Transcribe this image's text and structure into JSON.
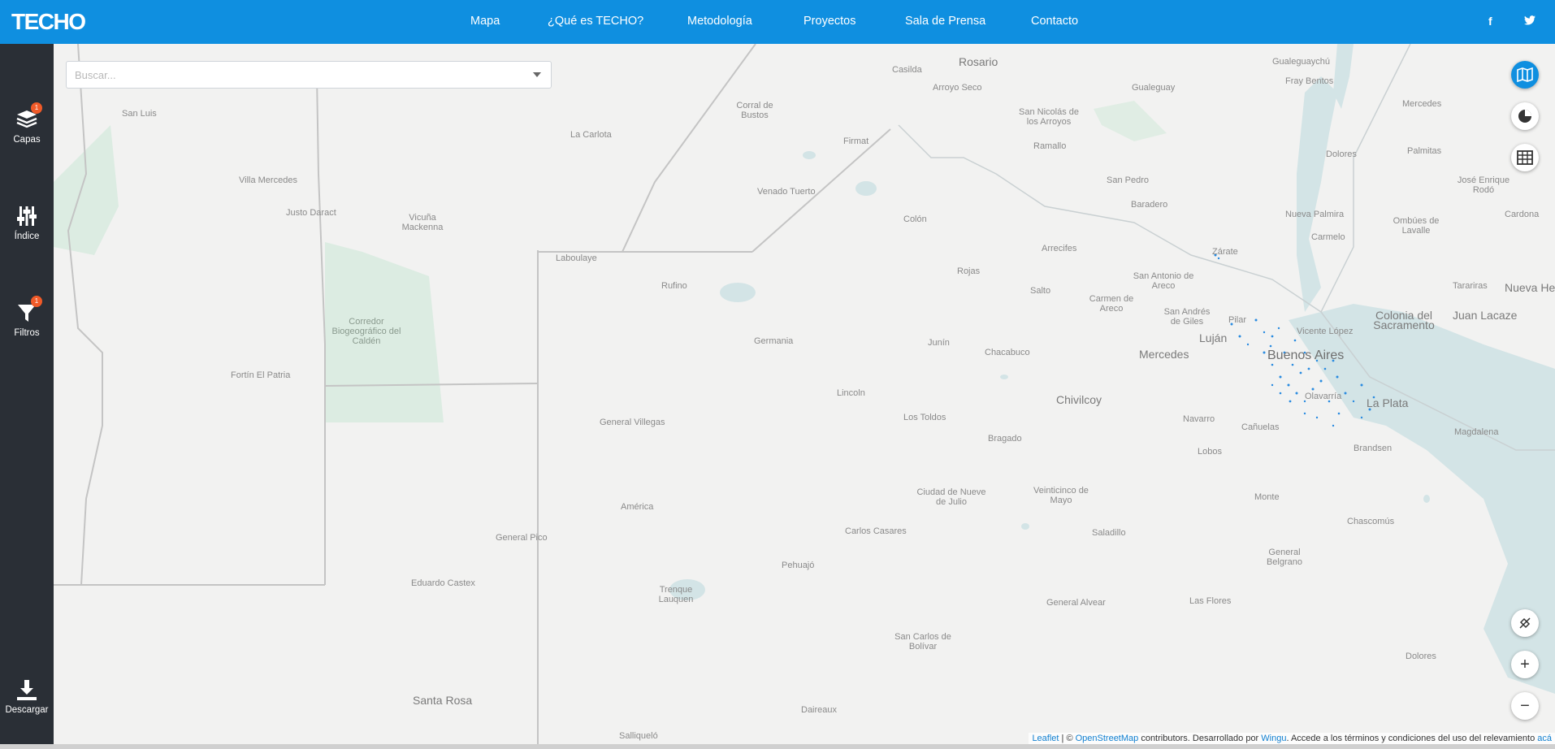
{
  "brand": {
    "logo_text": "TECHO"
  },
  "nav": {
    "items": [
      "Mapa",
      "¿Qué es TECHO?",
      "Metodología",
      "Proyectos",
      "Sala de Prensa",
      "Contacto"
    ],
    "social": [
      "f",
      "t"
    ]
  },
  "sidebar": {
    "layers": {
      "label": "Capas",
      "badge": "1"
    },
    "index": {
      "label": "Índice"
    },
    "filters": {
      "label": "Filtros",
      "badge": "1"
    },
    "download": {
      "label": "Descargar"
    }
  },
  "search": {
    "placeholder": "Buscar..."
  },
  "map": {
    "places": [
      "Rosario",
      "Casilda",
      "Arroyo Seco",
      "San Nicolás de los Arroyos",
      "Gualeguay",
      "Gualeguaychú",
      "Fray Bentos",
      "Mercedes",
      "San Luis",
      "Corral de Bustos",
      "La Carlota",
      "Firmat",
      "Ramallo",
      "Dolores",
      "Palmitas",
      "Villa Mercedes",
      "Justo Daract",
      "Venado Tuerto",
      "San Pedro",
      "Baradero",
      "José Enrique Rodó",
      "Nueva Palmira",
      "Ombúes de Lavalle",
      "Cardona",
      "Vicuña Mackenna",
      "Colón",
      "Carmelo",
      "Arrecifes",
      "Zárate",
      "Laboulaye",
      "Rojas",
      "Tarariras",
      "Nueva Helvecia",
      "Rufino",
      "San Antonio de Areco",
      "Salto",
      "Carmen de Areco",
      "San Andrés de Giles",
      "Pilar",
      "Colonia del Sacramento",
      "Juan Lacaze",
      "Corredor Biogeográfico del Caldén",
      "Germania",
      "Junín",
      "Chacabuco",
      "Luján",
      "Vicente López",
      "Buenos Aires",
      "Mercedes",
      "Fortín El Patria",
      "Lincoln",
      "Chivilcoy",
      "Olavarría",
      "La Plata",
      "Los Toldos",
      "Navarro",
      "Cañuelas",
      "Magdalena",
      "General Villegas",
      "Bragado",
      "Lobos",
      "Brandsen",
      "Ciudad de Nueve de Julio",
      "Veinticinco de Mayo",
      "Monte",
      "América",
      "Carlos Casares",
      "Saladillo",
      "Chascomús",
      "General Pico",
      "General Belgrano",
      "Pehuajó",
      "Trenque Lauquen",
      "Eduardo Castex",
      "General Alvear",
      "Las Flores",
      "San Carlos de Bolívar",
      "Dolores",
      "Santa Rosa",
      "Daireaux",
      "Salliqueló"
    ]
  },
  "attribution": {
    "leaflet": "Leaflet",
    "sep1": " | © ",
    "osm": "OpenStreetMap",
    "text1": " contributors. Desarrollado por ",
    "wingu": "Wingu",
    "text2": ". Accede a los términos y condiciones del uso del relevamiento ",
    "link": "acá"
  },
  "colors": {
    "brand": "#0f8fe0",
    "sidebar": "#2a2f36",
    "badge": "#f05a28",
    "water": "#d3e4e6",
    "park": "#dcece2"
  }
}
